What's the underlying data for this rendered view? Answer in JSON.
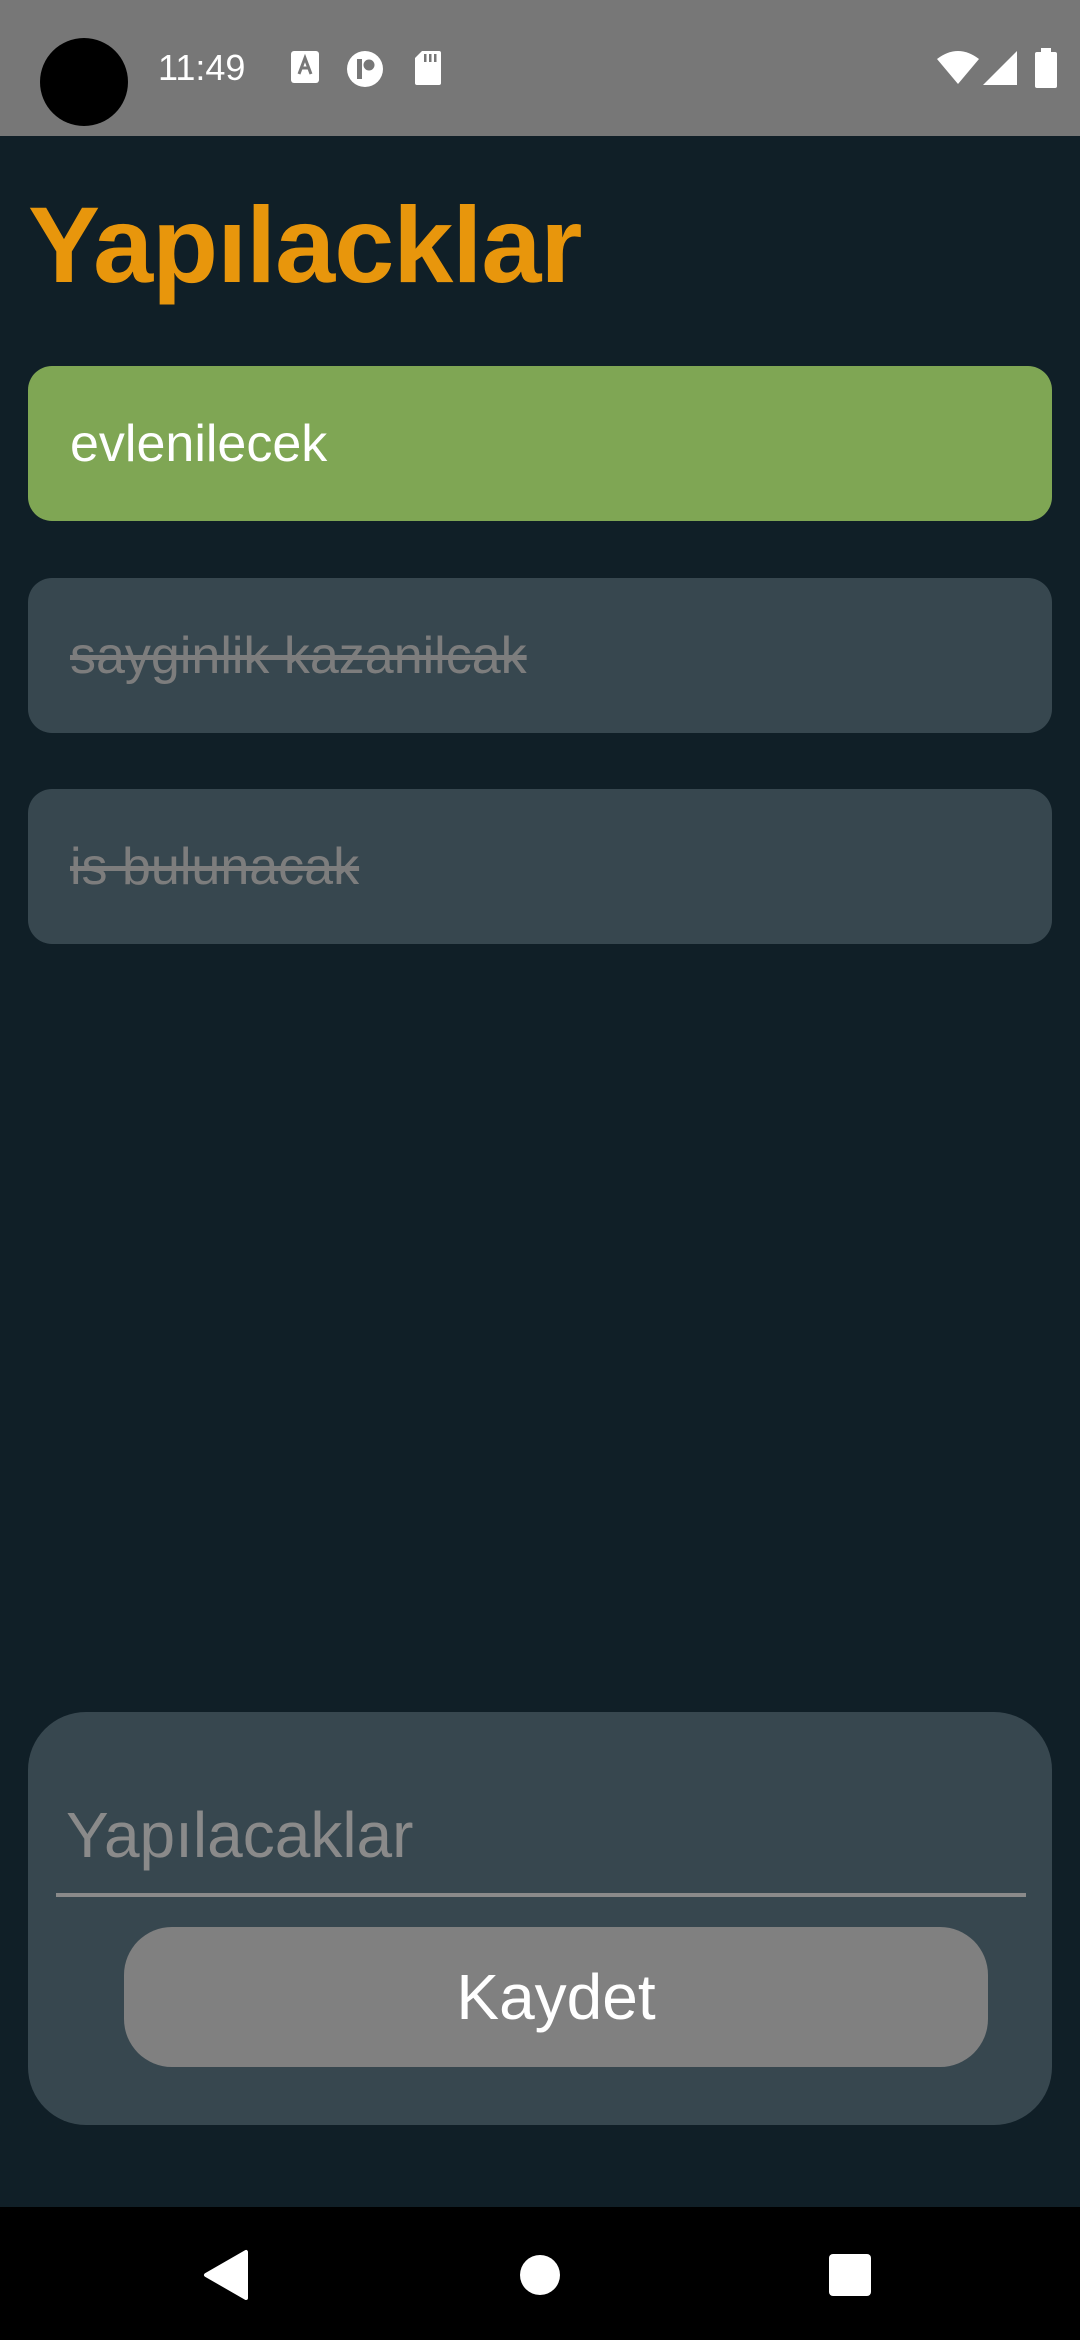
{
  "status_bar": {
    "time": "11:49",
    "icons": [
      "text-notification-icon",
      "app-notification-icon",
      "sd-card-icon",
      "wifi-icon",
      "cell-signal-icon",
      "battery-icon"
    ]
  },
  "header": {
    "title": "Yapılacklar"
  },
  "todos": [
    {
      "text": "evlenilecek",
      "done": false
    },
    {
      "text": "sayginlik kazanilcak",
      "done": true
    },
    {
      "text": "is bulunacak",
      "done": true
    }
  ],
  "form": {
    "input_placeholder": "Yapılacaklar",
    "input_value": "",
    "save_label": "Kaydet"
  },
  "nav": {
    "icons": [
      "back-icon",
      "home-icon",
      "recents-icon"
    ]
  },
  "colors": {
    "background": "#101f27",
    "accent": "#e8960c",
    "active_item": "#7fa654",
    "done_item": "#37474f",
    "button": "#808080"
  }
}
